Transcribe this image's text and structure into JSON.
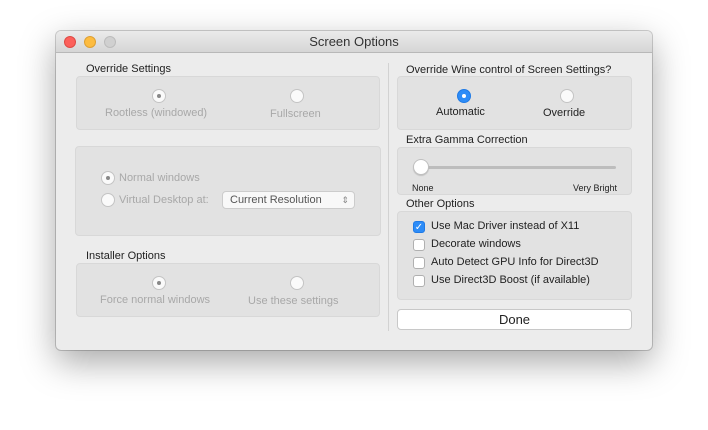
{
  "window": {
    "title": "Screen Options"
  },
  "override_settings": {
    "label": "Override Settings",
    "options": [
      "Rootless (windowed)",
      "Fullscreen"
    ],
    "selected": 0
  },
  "window_mode": {
    "options": [
      "Normal windows",
      "Virtual Desktop at:"
    ],
    "selected": 0,
    "resolution": "Current Resolution"
  },
  "installer_options": {
    "label": "Installer Options",
    "options": [
      "Force normal windows",
      "Use these settings"
    ],
    "selected": 0
  },
  "wine_control": {
    "label": "Override Wine control of Screen Settings?",
    "options": [
      "Automatic",
      "Override"
    ],
    "selected": 0
  },
  "gamma": {
    "label": "Extra Gamma Correction",
    "min_label": "None",
    "max_label": "Very Bright",
    "value": 0
  },
  "other_options": {
    "label": "Other Options",
    "items": [
      {
        "label": "Use Mac Driver instead of X11",
        "checked": true
      },
      {
        "label": "Decorate windows",
        "checked": false
      },
      {
        "label": "Auto Detect GPU Info for Direct3D",
        "checked": false
      },
      {
        "label": "Use Direct3D Boost (if available)",
        "checked": false
      }
    ]
  },
  "done_label": "Done",
  "colors": {
    "accent": "#2d8cf7",
    "close": "#fc605b",
    "minimize": "#fdbc40",
    "zoom": "#cfcfcf"
  }
}
